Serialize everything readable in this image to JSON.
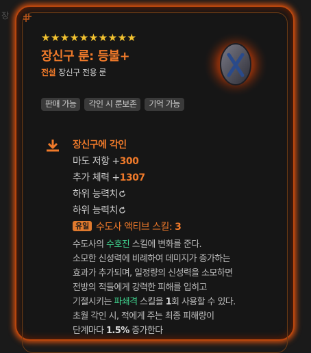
{
  "edge_label": "장",
  "item": {
    "stars": "★★★★★★★★★★",
    "title": "장신구 룬: 등불+",
    "grade": "전설",
    "subtype": "장신구 전용 룬",
    "rune_icon": "rune-stone-x-icon"
  },
  "tags": [
    "판매 가능",
    "각인 시 룬보존",
    "기억 가능"
  ],
  "engrave": {
    "title": "장신구에 각인",
    "icon": "download-arrow-icon",
    "stats": [
      {
        "label": "마도 저항 +",
        "value": "300"
      },
      {
        "label": "추가 체력 +",
        "value": "1307"
      }
    ],
    "sub_stats": [
      "하위 능력치",
      "하위 능력치"
    ],
    "badge": "유일",
    "skill_label": "수도사 액티브 스킬: ",
    "skill_value": "3"
  },
  "description": {
    "l1_a": "수도사의 ",
    "l1_green": "수호진",
    "l1_b": " 스킬에 변화를 준다.",
    "l2": "소모한 신성력에 비례하여 데미지가 증가하는",
    "l3": "효과가 추가되며, 일정량의 신성력을 소모하면",
    "l4": "전방의 적들에게 강력한 피해를 입히고",
    "l5_a": "기절시키는 ",
    "l5_green": "파쇄격",
    "l5_b": " 스킬을 ",
    "l5_bold": "1",
    "l5_c": "회 사용할 수 있다.",
    "l6": "초월 각인 시, 적에게 주는 최종 피해량이",
    "l7_a": "단계마다 ",
    "l7_bold": "1.5%",
    "l7_b": " 증가한다"
  }
}
